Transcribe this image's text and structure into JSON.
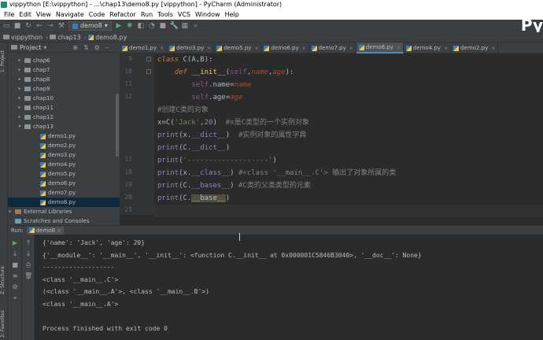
{
  "window": {
    "title": "vippython [E:\\vippython] - ...\\chap13\\demo8.py [vippython] - PyCharm (Administrator)",
    "brand": "Py"
  },
  "menu": [
    "File",
    "Edit",
    "View",
    "Navigate",
    "Code",
    "Refactor",
    "Run",
    "Tools",
    "VCS",
    "Window",
    "Help"
  ],
  "toolbar": {
    "run_config": "demo8"
  },
  "breadcrumb": [
    "vippython",
    "chap13",
    "demo8.py"
  ],
  "project_panel": {
    "title": "Project",
    "tree": [
      {
        "label": "chap6",
        "kind": "folder",
        "expanded": false
      },
      {
        "label": "chap7",
        "kind": "folder",
        "expanded": false
      },
      {
        "label": "chap8",
        "kind": "folder",
        "expanded": false
      },
      {
        "label": "chap9",
        "kind": "folder",
        "expanded": false
      },
      {
        "label": "chap10",
        "kind": "folder",
        "expanded": false
      },
      {
        "label": "chap11",
        "kind": "folder",
        "expanded": false
      },
      {
        "label": "chap12",
        "kind": "folder",
        "expanded": false
      },
      {
        "label": "chap13",
        "kind": "folder",
        "expanded": true
      },
      {
        "label": "demo1.py",
        "kind": "file"
      },
      {
        "label": "demo2.py",
        "kind": "file"
      },
      {
        "label": "demo3.py",
        "kind": "file"
      },
      {
        "label": "demo4.py",
        "kind": "file"
      },
      {
        "label": "demo5.py",
        "kind": "file"
      },
      {
        "label": "demo6.py",
        "kind": "file"
      },
      {
        "label": "demo7.py",
        "kind": "file"
      },
      {
        "label": "demo8.py",
        "kind": "file",
        "selected": true
      },
      {
        "label": "External Libraries",
        "kind": "lib",
        "expanded": false
      },
      {
        "label": "Scratches and Consoles",
        "kind": "scratch"
      }
    ]
  },
  "side_tabs": {
    "project": "1: Project",
    "structure": "Z: Structure",
    "favorites": "2: Favorites"
  },
  "editor_tabs": [
    "demo1.py",
    "demo3.py",
    "demo5.py",
    "demo6.py",
    "demo7.py",
    "demo8.py",
    "demo4.py",
    "demo2.py"
  ],
  "active_tab": "demo8.py",
  "code_lines": [
    {
      "n": "9",
      "html": "<span class=\"kw\">class</span> C(A,B):"
    },
    {
      "n": "10",
      "html": "    <span class=\"kw\">def</span> <span class=\"fn\">__init__</span>(<span class=\"pa\">self</span>,<span class=\"it\">name</span>,<span class=\"it\">age</span>):"
    },
    {
      "n": "11",
      "html": "        <span class=\"pa\">self</span>.name=<span class=\"it\">name</span>"
    },
    {
      "n": "12",
      "html": "        <span class=\"pa\">self</span>.age=<span class=\"it\">age</span>"
    },
    {
      "n": "",
      "html": "<span class=\"cm\">#创建C类的对象</span>"
    },
    {
      "n": "",
      "html": "x=C(<span class=\"st\">'Jack'</span>,<span class=\"nu\">20</span>)  <span class=\"cm\">#x是C类型的一个实例对象</span>"
    },
    {
      "n": "",
      "html": "<span class=\"fnc\">print</span>(x.<span class=\"fnc\">__dict__</span>)  <span class=\"cm\">#实例对象的属性字典</span>"
    },
    {
      "n": "",
      "html": "<span class=\"fnc\">print</span>(C.<span class=\"fnc\">__dict__</span>)"
    },
    {
      "n": "17",
      "html": "<span class=\"fnc\">print</span>(<span class=\"st\">'-------------------'</span>)"
    },
    {
      "n": "18",
      "html": "<span class=\"fnc\">print</span>(x.<span class=\"fnc\">__class__</span>) <span class=\"cm\">#&lt;class '__main__.C'&gt; 输出了对象所属的类</span>"
    },
    {
      "n": "19",
      "html": "<span class=\"fnc\">print</span>(C.<span class=\"fnc\">__bases__</span>) <span class=\"cm\">#C类的父类类型的元素</span>"
    },
    {
      "n": "20",
      "html": "<span class=\"fnc\">print</span>(C.<span class=\"hl\">__base__</span>)"
    },
    {
      "n": "21",
      "html": ""
    }
  ],
  "run_panel": {
    "tab_label": "Run:",
    "config": "demo8",
    "output": [
      "{'name': 'Jack', 'age': 20}",
      "{'__module__': '__main__', '__init__': <function C.__init__ at 0x000001C5846B3040>, '__doc__': None}",
      "-------------------",
      "<class '__main__.C'>",
      "(<class '__main__.A'>, <class '__main__.B'>)",
      "<class '__main__.A'>",
      "",
      "Process finished with exit code 0"
    ]
  }
}
